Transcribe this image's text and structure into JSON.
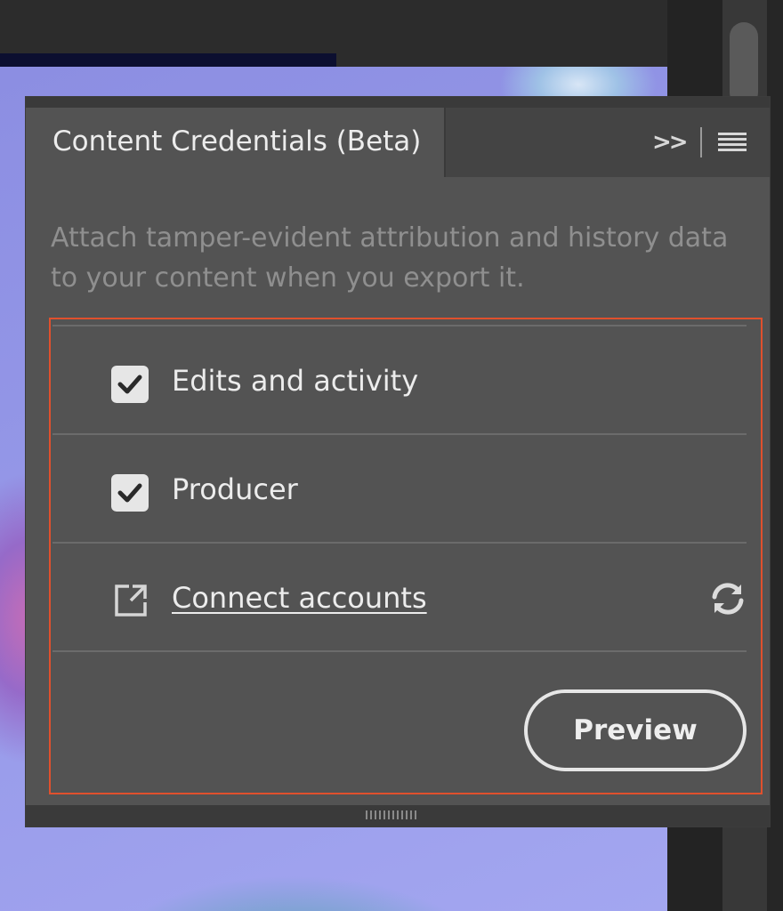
{
  "panel": {
    "tab_title": "Content Credentials (Beta)",
    "collapse_icon": "double-chevron-right-icon",
    "menu_icon": "hamburger-menu-icon",
    "description": "Attach tamper-evident attribution and history data to your content when you export it.",
    "options": [
      {
        "label": "Edits and activity",
        "checked": true
      },
      {
        "label": "Producer",
        "checked": true
      }
    ],
    "connect": {
      "label": "Connect accounts",
      "icon": "external-link-icon",
      "refresh_icon": "refresh-icon"
    },
    "preview_button": "Preview"
  },
  "colors": {
    "panel_bg": "#535353",
    "highlight_border": "#e0502d",
    "text_primary": "#ececec",
    "text_muted": "#8f8f8f"
  }
}
